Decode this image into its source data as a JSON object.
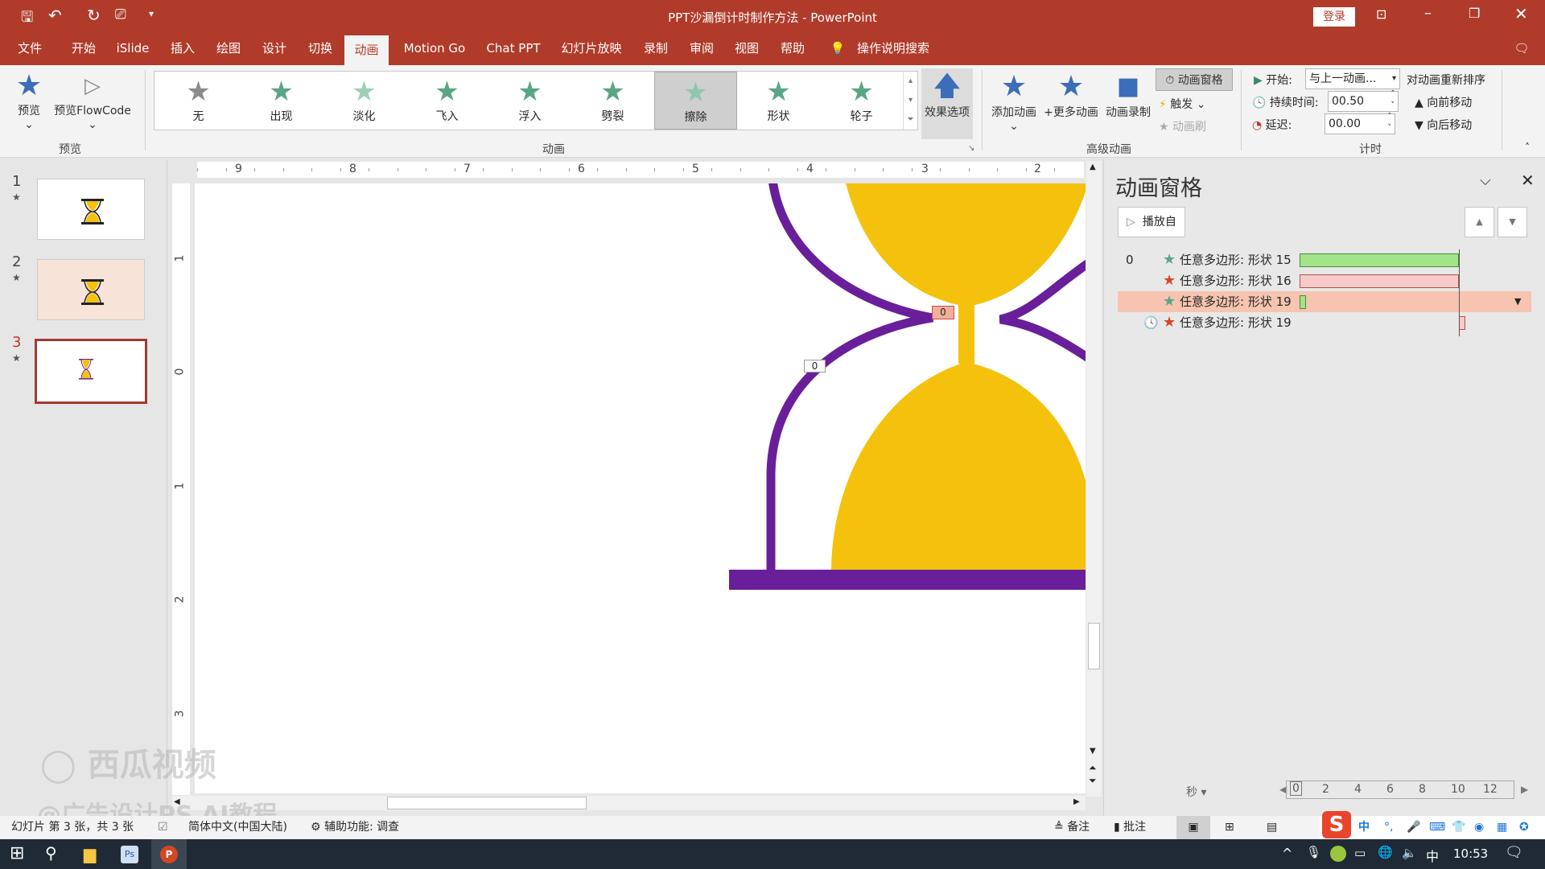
{
  "window": {
    "title": "PPT沙漏倒计时制作方法 - PowerPoint",
    "login": "登录"
  },
  "tabs": [
    "文件",
    "开始",
    "iSlide",
    "插入",
    "绘图",
    "设计",
    "切换",
    "动画",
    "Motion Go",
    "Chat PPT",
    "幻灯片放映",
    "录制",
    "审阅",
    "视图",
    "帮助"
  ],
  "active_tab": "动画",
  "search": "操作说明搜索",
  "ribbon": {
    "preview": {
      "label": "预览",
      "flowcode": "预览FlowCode",
      "group": "预览"
    },
    "gallery": {
      "group": "动画",
      "items": [
        {
          "label": "无",
          "color": "#8a8a8a"
        },
        {
          "label": "出现",
          "color": "#5aa585"
        },
        {
          "label": "淡化",
          "color": "#9fcfb8"
        },
        {
          "label": "飞入",
          "color": "#5aa585"
        },
        {
          "label": "浮入",
          "color": "#5aa585"
        },
        {
          "label": "劈裂",
          "color": "#5aa585"
        },
        {
          "label": "擦除",
          "color": "#8fc7ae",
          "selected": true
        },
        {
          "label": "形状",
          "color": "#5aa585"
        },
        {
          "label": "轮子",
          "color": "#5aa585"
        }
      ],
      "effect_options": "效果选项"
    },
    "advanced": {
      "group": "高级动画",
      "add": "添加动画",
      "more": "+更多动画",
      "record": "动画录制",
      "pane": "动画窗格",
      "trigger": "触发",
      "painter": "动画刷"
    },
    "timing": {
      "group": "计时",
      "start_label": "开始:",
      "start_value": "与上一动画...",
      "duration_label": "持续时间:",
      "duration_value": "00.50",
      "delay_label": "延迟:",
      "delay_value": "00.00",
      "reorder": "对动画重新排序",
      "move_earlier": "向前移动",
      "move_later": "向后移动"
    }
  },
  "slides": [
    {
      "num": "1"
    },
    {
      "num": "2"
    },
    {
      "num": "3",
      "selected": true
    }
  ],
  "ruler": {
    "h": [
      "9",
      "8",
      "7",
      "6",
      "5",
      "4",
      "3",
      "2"
    ],
    "v": [
      "1",
      "0",
      "1",
      "2",
      "3"
    ]
  },
  "slide_tags": [
    "0",
    "0"
  ],
  "anim_pane": {
    "title": "动画窗格",
    "play_from": "播放自",
    "items": [
      {
        "index": "0",
        "type": "entrance",
        "label": "任意多边形: 形状 15",
        "bar_start": 0,
        "bar_end": 0.5,
        "bar_color": "#a3e48a"
      },
      {
        "index": "",
        "type": "exit",
        "label": "任意多边形: 形状 16",
        "bar_start": 0,
        "bar_end": 0.5,
        "bar_color": "#f9c9c9"
      },
      {
        "index": "",
        "type": "entrance",
        "label": "任意多边形: 形状 19",
        "bar_start": 0,
        "bar_end": 0.02,
        "bar_color": "#a3e48a",
        "selected": true
      },
      {
        "index": "",
        "type": "exit",
        "trigger": "after-previous",
        "label": "任意多边形: 形状 19",
        "bar_start": 0.5,
        "bar_end": 0.52,
        "bar_color": "#f9c9c9"
      }
    ],
    "unit": "秒",
    "scale": [
      "0",
      "2",
      "4",
      "6",
      "8",
      "10",
      "12"
    ]
  },
  "status": {
    "slide": "幻灯片 第 3 张，共 3 张",
    "language": "简体中文(中国大陆)",
    "accessibility": "辅助功能: 调查",
    "notes": "备注",
    "comments": "批注"
  },
  "taskbar": {
    "time": "10:53",
    "ime": "中"
  },
  "watermark": {
    "brand": "西瓜视频",
    "author": "@广告设计PS AI教程"
  },
  "colors": {
    "accent": "#b03b2b",
    "hourglass_frame": "#6a1f9a",
    "sand": "#f4c20d"
  }
}
